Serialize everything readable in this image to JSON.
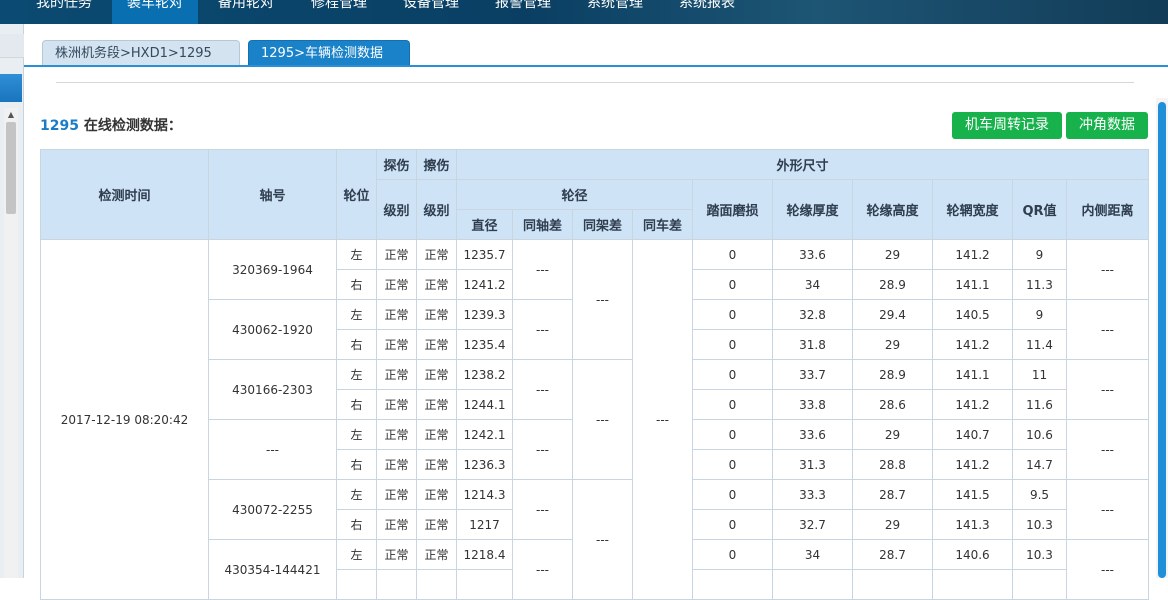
{
  "topnav": {
    "items": [
      "我的任务",
      "装车轮对",
      "备用轮对",
      "修程管理",
      "设备管理",
      "报警管理",
      "系统管理",
      "系统报表"
    ],
    "active_index": 1
  },
  "tabs": [
    {
      "label": "株洲机务段>HXD1>1295",
      "active": false
    },
    {
      "label": "1295>车辆检测数据",
      "close": "×",
      "active": true
    }
  ],
  "heading": {
    "number": "1295",
    "text": " 在线检测数据："
  },
  "buttons": {
    "turnover": "机车周转记录",
    "impact": "冲角数据"
  },
  "table": {
    "headers": {
      "time": "检测时间",
      "axle": "轴号",
      "position": "轮位",
      "flaw": "探伤",
      "scratch": "擦伤",
      "level": "级别",
      "dimensions": "外形尺寸",
      "diameter_group": "轮径",
      "diameter": "直径",
      "same_axle": "同轴差",
      "same_frame": "同架差",
      "same_car": "同车差",
      "tread_wear": "踏面磨损",
      "flange_thickness": "轮缘厚度",
      "flange_height": "轮缘高度",
      "rim_width": "轮辋宽度",
      "qr": "QR值",
      "inner_distance": "内侧距离"
    },
    "time_value": "2017-12-19 08:20:42",
    "placeholder": "---",
    "axles": [
      {
        "id": "320369-1964",
        "rows": [
          {
            "pos": "左",
            "flaw": "正常",
            "scratch": "正常",
            "dia": "1235.7",
            "wear": "0",
            "ft": "33.6",
            "fh": "29",
            "rw": "141.2",
            "qr": "9"
          },
          {
            "pos": "右",
            "flaw": "正常",
            "scratch": "正常",
            "dia": "1241.2",
            "wear": "0",
            "ft": "34",
            "fh": "28.9",
            "rw": "141.1",
            "qr": "11.3"
          }
        ]
      },
      {
        "id": "430062-1920",
        "rows": [
          {
            "pos": "左",
            "flaw": "正常",
            "scratch": "正常",
            "dia": "1239.3",
            "wear": "0",
            "ft": "32.8",
            "fh": "29.4",
            "rw": "140.5",
            "qr": "9"
          },
          {
            "pos": "右",
            "flaw": "正常",
            "scratch": "正常",
            "dia": "1235.4",
            "wear": "0",
            "ft": "31.8",
            "fh": "29",
            "rw": "141.2",
            "qr": "11.4"
          }
        ]
      },
      {
        "id": "430166-2303",
        "rows": [
          {
            "pos": "左",
            "flaw": "正常",
            "scratch": "正常",
            "dia": "1238.2",
            "wear": "0",
            "ft": "33.7",
            "fh": "28.9",
            "rw": "141.1",
            "qr": "11"
          },
          {
            "pos": "右",
            "flaw": "正常",
            "scratch": "正常",
            "dia": "1244.1",
            "wear": "0",
            "ft": "33.8",
            "fh": "28.6",
            "rw": "141.2",
            "qr": "11.6"
          }
        ]
      },
      {
        "id": "---",
        "rows": [
          {
            "pos": "左",
            "flaw": "正常",
            "scratch": "正常",
            "dia": "1242.1",
            "wear": "0",
            "ft": "33.6",
            "fh": "29",
            "rw": "140.7",
            "qr": "10.6"
          },
          {
            "pos": "右",
            "flaw": "正常",
            "scratch": "正常",
            "dia": "1236.3",
            "wear": "0",
            "ft": "31.3",
            "fh": "28.8",
            "rw": "141.2",
            "qr": "14.7"
          }
        ]
      },
      {
        "id": "430072-2255",
        "rows": [
          {
            "pos": "左",
            "flaw": "正常",
            "scratch": "正常",
            "dia": "1214.3",
            "wear": "0",
            "ft": "33.3",
            "fh": "28.7",
            "rw": "141.5",
            "qr": "9.5"
          },
          {
            "pos": "右",
            "flaw": "正常",
            "scratch": "正常",
            "dia": "1217",
            "wear": "0",
            "ft": "32.7",
            "fh": "29",
            "rw": "141.3",
            "qr": "10.3"
          }
        ]
      },
      {
        "id": "430354-144421",
        "rows": [
          {
            "pos": "左",
            "flaw": "正常",
            "scratch": "正常",
            "dia": "1218.4",
            "wear": "0",
            "ft": "34",
            "fh": "28.7",
            "rw": "140.6",
            "qr": "10.3"
          },
          {
            "pos": "",
            "flaw": "",
            "scratch": "",
            "dia": "",
            "wear": "",
            "ft": "",
            "fh": "",
            "rw": "",
            "qr": ""
          }
        ]
      }
    ]
  }
}
